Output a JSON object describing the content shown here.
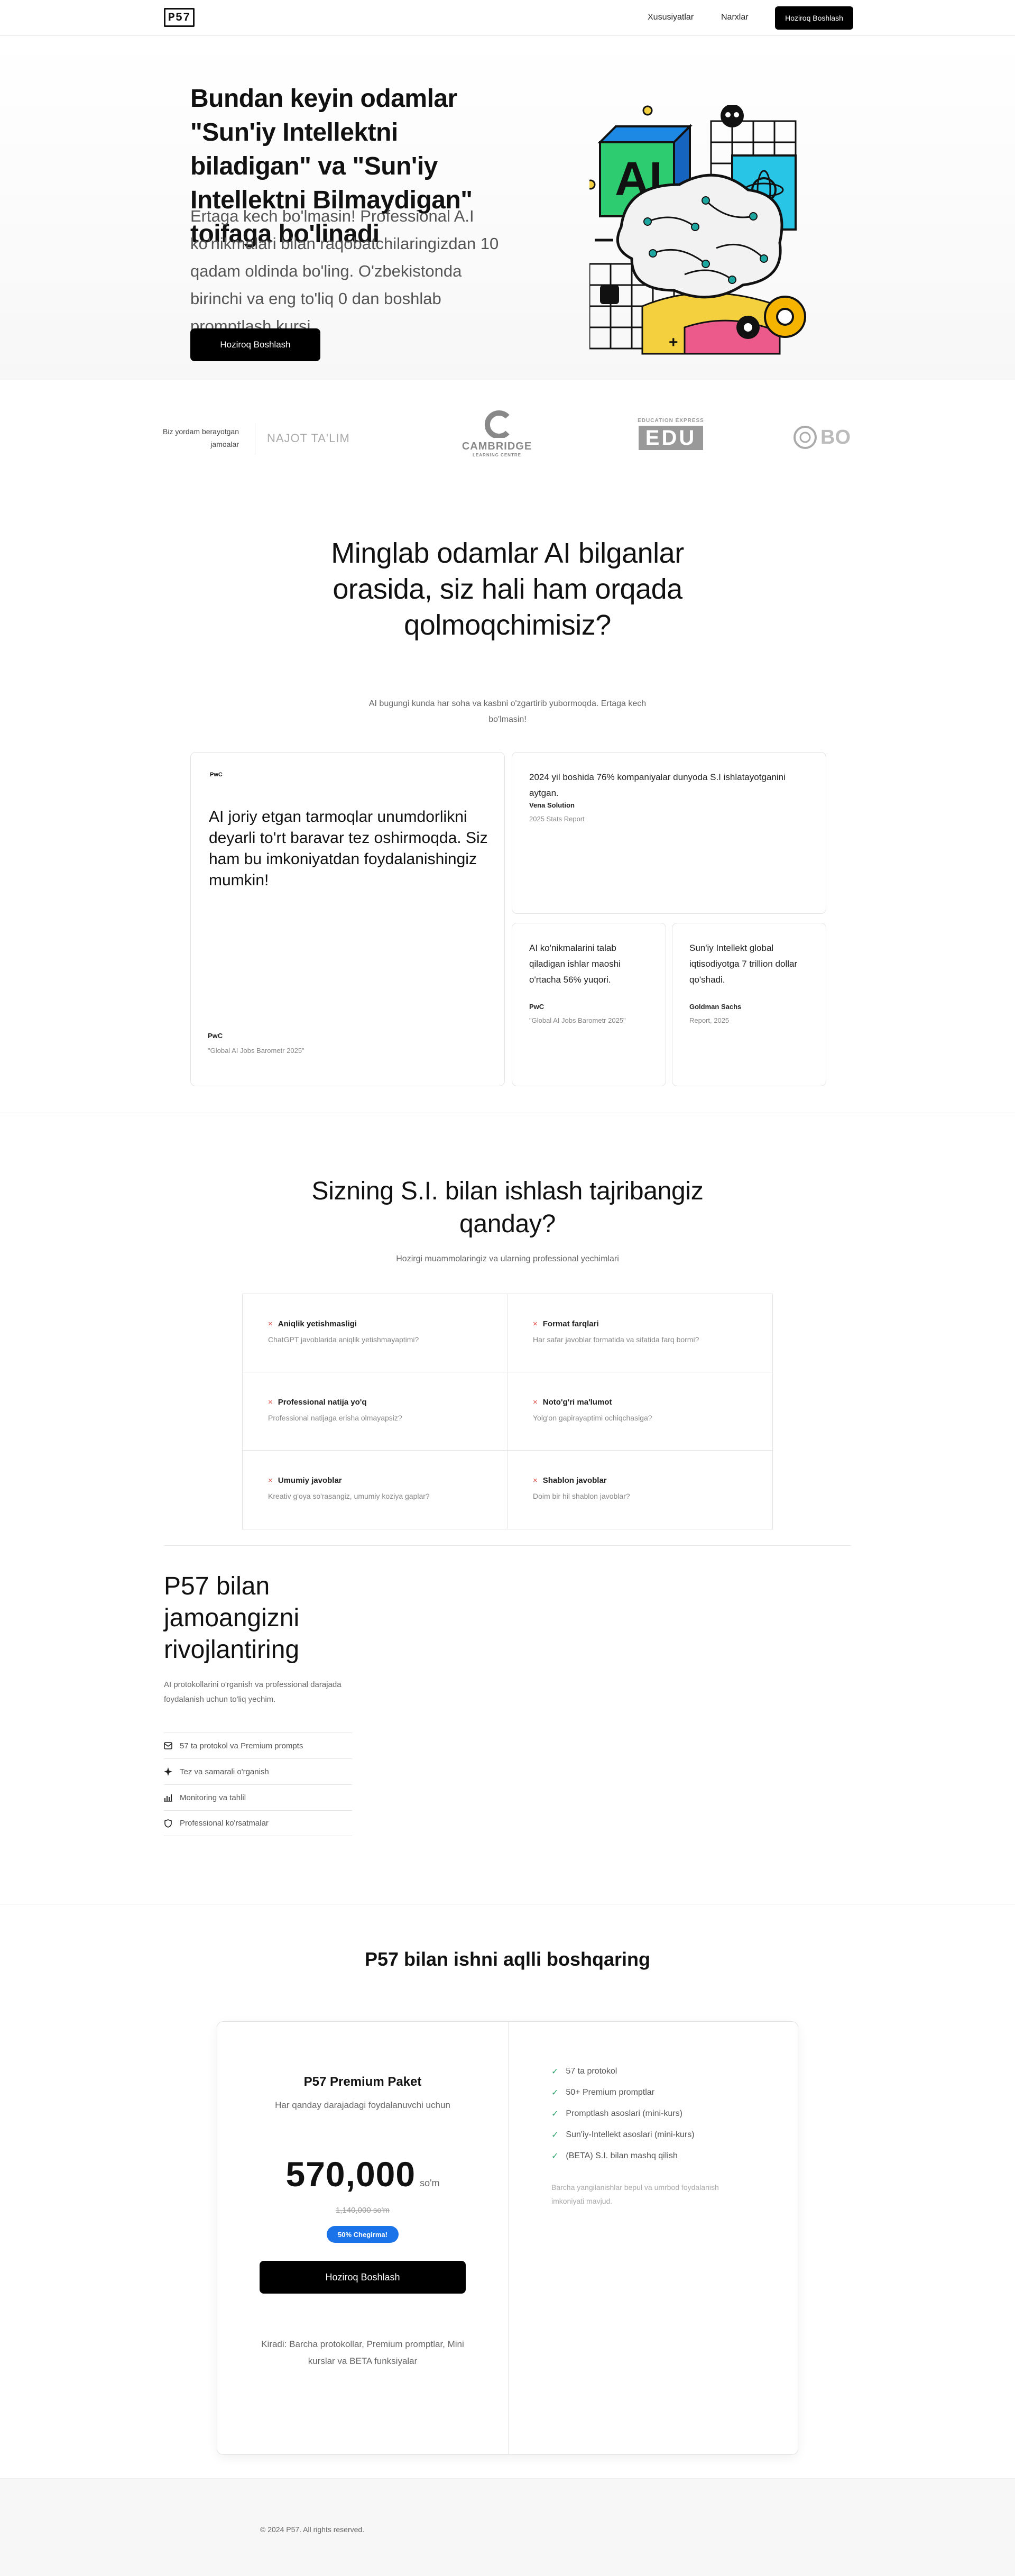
{
  "nav": {
    "logo": "P57",
    "links": [
      "Xususiyatlar",
      "Narxlar"
    ],
    "cta": "Hoziroq Boshlash"
  },
  "hero": {
    "title": "Bundan keyin odamlar \"Sun'iy Intellektni biladigan\" va \"Sun'iy Intellektni Bilmaydigan\" toifaga bo'linadi",
    "description": "Ertaga kech bo'lmasin! Professional A.I ko'nikmalari bilan raqobatchilaringizdan 10 qadam oldinda bo'ling. O'zbekistonda birinchi va eng to'liq 0 dan boshlab promptlash kursi.",
    "button": "Hoziroq Boshlash",
    "art_text": "AI"
  },
  "partners": {
    "label": "Biz yordam berayotgan jamoalar",
    "logos": [
      "NAJOT TA'LIM",
      "CAMBRIDGE",
      "LEARNING CENTRE",
      "EDUCATION EXPRESS",
      "EDU",
      "BO"
    ]
  },
  "stats": {
    "title": "Minglab odamlar AI bilganlar orasida, siz hali ham orqada qolmoqchimisiz?",
    "subtitle": "AI bugungi kunda har soha va kasbni o'zgartirib yubormoqda. Ertaga kech bo'lmasin!",
    "cards": [
      {
        "badge": "PwC",
        "quote": "AI joriy etgan tarmoqlar unumdorlikni deyarli to'rt baravar tez oshirmoqda. Siz ham bu imkoniyatdan foydalanishingiz mumkin!",
        "source": "PwC",
        "detail": "\"Global AI Jobs Barometr 2025\""
      },
      {
        "quote": "2024 yil boshida 76% kompaniyalar dunyoda S.I ishlatayotganini aytgan.",
        "source": "Vena Solution",
        "detail": "2025 Stats Report"
      },
      {
        "quote": "AI ko'nikmalarini talab qiladigan ishlar maoshi o'rtacha 56% yuqori.",
        "source": "PwC",
        "detail": "\"Global AI Jobs Barometr 2025\""
      },
      {
        "quote": "Sun'iy Intellekt global iqtisodiyotga 7 trillion dollar qo'shadi.",
        "source": "Goldman Sachs",
        "detail": "Report, 2025"
      }
    ]
  },
  "experience": {
    "title": "Sizning S.I. bilan ishlash tajribangiz qanday?",
    "subtitle": "Hozirgi muammolaringiz va ularning professional yechimlari",
    "items": [
      {
        "title": "Aniqlik yetishmasligi",
        "desc": "ChatGPT javoblarida aniqlik yetishmayaptimi?"
      },
      {
        "title": "Format farqlari",
        "desc": "Har safar javoblar formatida va sifatida farq bormi?"
      },
      {
        "title": "Professional natija yo'q",
        "desc": "Professional natijaga erisha olmayapsiz?"
      },
      {
        "title": "Noto'g'ri ma'lumot",
        "desc": "Yolg'on gapirayaptimi ochiqchasiga?"
      },
      {
        "title": "Umumiy javoblar",
        "desc": "Kreativ g'oya so'rasangiz, umumiy koziya gaplar?"
      },
      {
        "title": "Shablon javoblar",
        "desc": "Doim bir hil shablon javoblar?"
      }
    ],
    "mark": "×"
  },
  "team": {
    "title": "P57 bilan jamoangizni rivojlantiring",
    "description": "AI protokollarini o'rganish va professional darajada foydalanish uchun to'liq yechim.",
    "features": [
      {
        "icon": "mail-icon",
        "label": "57 ta protokol va Premium prompts"
      },
      {
        "icon": "sparkle-icon",
        "label": "Tez va samarali o'rganish"
      },
      {
        "icon": "chart-icon",
        "label": "Monitoring va tahlil"
      },
      {
        "icon": "shield-icon",
        "label": "Professional ko'rsatmalar"
      }
    ]
  },
  "pricing": {
    "title": "P57 bilan ishni aqlli boshqaring",
    "package": "P57 Premium Paket",
    "package_sub": "Har qanday darajadagi foydalanuvchi uchun",
    "price": "570,000",
    "currency": "so'm",
    "old_price": "1,140,000 so'm",
    "badge": "50% Chegirma!",
    "button": "Hoziroq Boshlash",
    "note": "Kiradi: Barcha protokollar, Premium promptlar, Mini kurslar va BETA funksiyalar",
    "features": [
      "57 ta protokol",
      "50+ Premium promptlar",
      "Promptlash asoslari (mini-kurs)",
      "Sun'iy-Intellekt asoslari (mini-kurs)",
      "(BETA) S.I. bilan mashq qilish"
    ],
    "check": "✓",
    "footnote": "Barcha yangilanishlar bepul va umrbod foydalanish imkoniyati mavjud."
  },
  "footer": {
    "copyright": "© 2024 P57. All rights reserved."
  }
}
